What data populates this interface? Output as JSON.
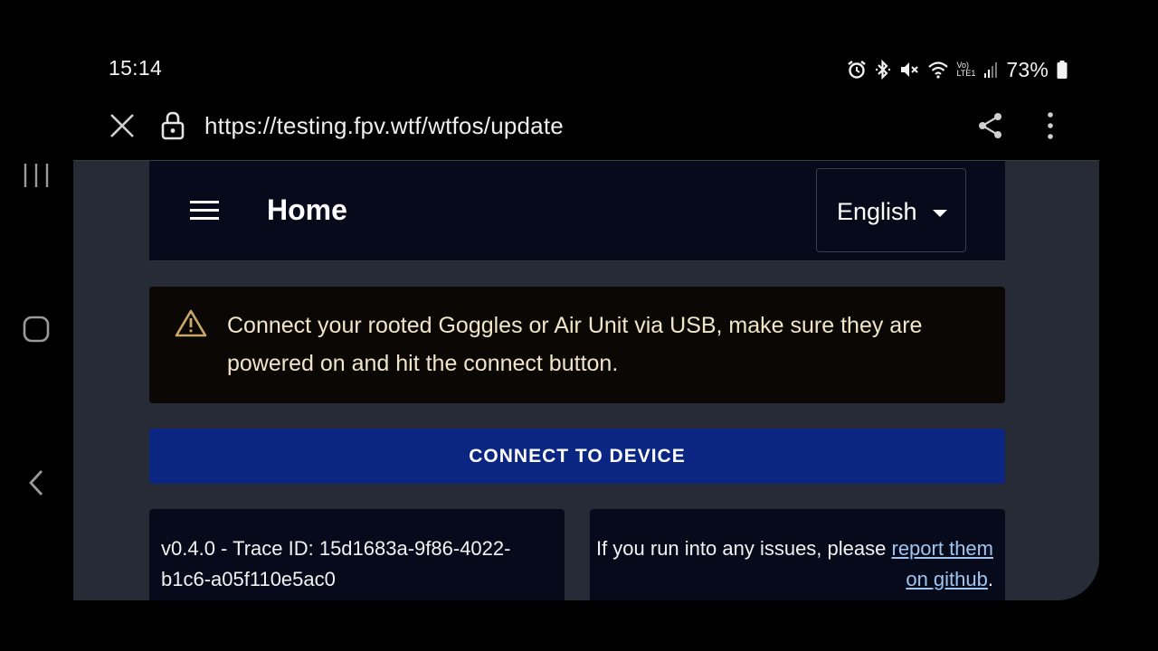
{
  "status_bar": {
    "time": "15:14",
    "battery": "73%",
    "network_sim": "6",
    "network_label_top": "Vo)",
    "network_label_bottom": "LTE1",
    "icons": [
      "alarm-icon",
      "bluetooth-icon",
      "mute-icon",
      "wifi-icon",
      "signal-icon",
      "battery-icon"
    ]
  },
  "browser": {
    "url": "https://testing.fpv.wtf/wtfos/update",
    "icons": [
      "close-icon",
      "lock-icon",
      "share-icon",
      "more-vert-icon"
    ]
  },
  "app": {
    "title": "Home",
    "language": "English"
  },
  "alert": {
    "message": "Connect your rooted Goggles or Air Unit via USB, make sure they are powered on and hit the connect button."
  },
  "connect_button": "CONNECT TO DEVICE",
  "footer": {
    "version": "v0.4.0 - Trace ID: 15d1683a-9f86-4022-b1c6-a05f110e5ac0",
    "issues_prefix": "If you run into any issues, please",
    "issues_link": "report them on github",
    "issues_suffix": "."
  },
  "colors": {
    "page_bg": "#272b36",
    "appbar_bg": "#060a1a",
    "button_bg": "#0a2582",
    "alert_text": "#f1e6c8",
    "warn_icon": "#c9a86a",
    "link": "#9fc6f0"
  }
}
